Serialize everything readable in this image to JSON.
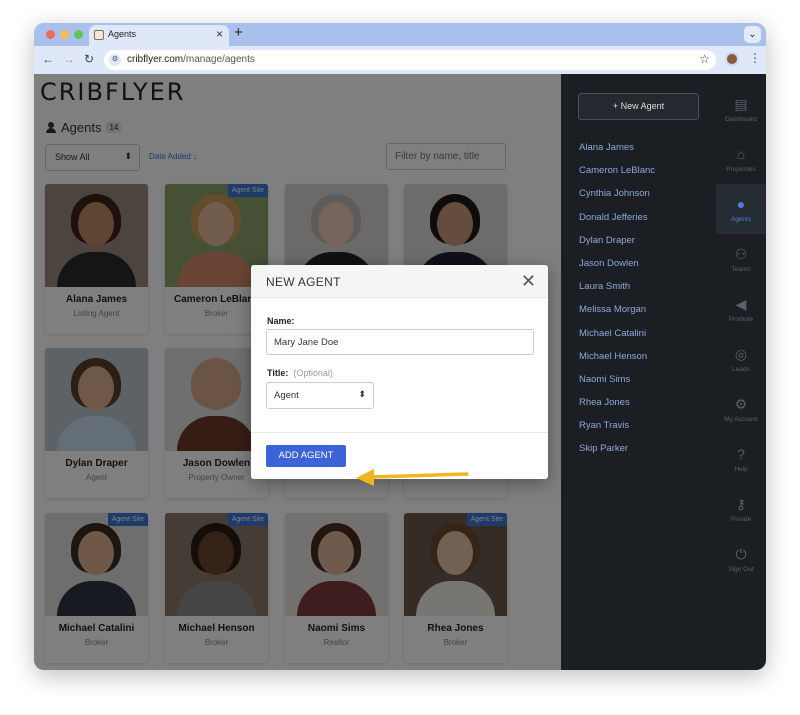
{
  "browser": {
    "tab_title": "Agents",
    "tab_close": "×",
    "new_tab": "+",
    "url_host": "cribflyer.com",
    "url_path": "/manage/agents",
    "menu_glyph": "⌄"
  },
  "page": {
    "logo": "CRIBFLYER",
    "heading": "Agents",
    "count": "14",
    "show_filter": "Show All",
    "sort_label": "Date Added ↓",
    "search_placeholder": "Filter by name, title",
    "badge_text": "Agent Site"
  },
  "cards": [
    {
      "name": "Alana James",
      "role": "Listing Agent",
      "badge": false,
      "skin": "#c28a66",
      "hair": "#3a2216",
      "body": "#2b2b2b"
    },
    {
      "name": "Cameron LeBlanc",
      "role": "Broker",
      "badge": true,
      "skin": "#e2b99a",
      "hair": "#c89a5a",
      "body": "#d48a6a"
    },
    {
      "name": "",
      "role": "",
      "badge": false,
      "skin": "#e8c8b4",
      "hair": "#b8b8b8",
      "body": "#222222"
    },
    {
      "name": "",
      "role": "",
      "badge": false,
      "skin": "#c89a78",
      "hair": "#1e1a18",
      "body": "#1d2430"
    },
    {
      "name": "Dylan Draper",
      "role": "Agent",
      "badge": false,
      "skin": "#e0b090",
      "hair": "#5a3e28",
      "body": "#c9dcee"
    },
    {
      "name": "Jason Dowlen",
      "role": "Property Owner",
      "badge": false,
      "skin": "#d8a888",
      "hair": "#d8a888",
      "body": "#6a3b2a"
    },
    {
      "name": "",
      "role": "",
      "badge": false,
      "skin": "#cccccc",
      "hair": "#bbbbbb",
      "body": "#aaaaaa"
    },
    {
      "name": "",
      "role": "",
      "badge": false,
      "skin": "#cccccc",
      "hair": "#bbbbbb",
      "body": "#aaaaaa"
    },
    {
      "name": "Michael Catalini",
      "role": "Broker",
      "badge": true,
      "skin": "#dcae8c",
      "hair": "#3a2a20",
      "body": "#2e3540"
    },
    {
      "name": "Michael Henson",
      "role": "Broker",
      "badge": true,
      "skin": "#6a452e",
      "hair": "#2a1a12",
      "body": "#8a8a8a"
    },
    {
      "name": "Naomi Sims",
      "role": "Realtor",
      "badge": false,
      "skin": "#e0b49a",
      "hair": "#4a2a1e",
      "body": "#7a3a3a"
    },
    {
      "name": "Rhea Jones",
      "role": "Broker",
      "badge": true,
      "skin": "#e4c0a6",
      "hair": "#6a4a32",
      "body": "#f0ece6"
    }
  ],
  "sidebar": {
    "new_agent_label": "+  New Agent",
    "agents": [
      "Alana James",
      "Cameron LeBlanc",
      "Cynthia Johnson",
      "Donald Jefferies",
      "Dylan Draper",
      "Jason Dowlen",
      "Laura Smith",
      "Melissa Morgan",
      "Michael Catalini",
      "Michael Henson",
      "Naomi Sims",
      "Rhea Jones",
      "Ryan Travis",
      "Skip Parker"
    ]
  },
  "rail": [
    {
      "label": "Dashboard",
      "glyph": "▤",
      "icon": "dashboard-icon",
      "active": false
    },
    {
      "label": "Properties",
      "glyph": "⌂",
      "icon": "properties-icon",
      "active": false
    },
    {
      "label": "Agents",
      "glyph": "●",
      "icon": "agents-icon",
      "active": true
    },
    {
      "label": "Teams",
      "glyph": "⚇",
      "icon": "teams-icon",
      "active": false
    },
    {
      "label": "Promote",
      "glyph": "◀",
      "icon": "megaphone-icon",
      "active": false
    },
    {
      "label": "Leads",
      "glyph": "◎",
      "icon": "leads-icon",
      "active": false
    },
    {
      "label": "My Account",
      "glyph": "⚙",
      "icon": "gear-icon",
      "active": false
    },
    {
      "label": "Help",
      "glyph": "?",
      "icon": "help-icon",
      "active": false
    },
    {
      "label": "Private",
      "glyph": "⚷",
      "icon": "key-icon",
      "active": false
    },
    {
      "label": "Sign Out",
      "glyph": "⏻",
      "icon": "power-icon",
      "active": false
    }
  ],
  "modal": {
    "title": "NEW AGENT",
    "close": "✕",
    "name_label": "Name:",
    "name_value": "Mary Jane Doe",
    "title_label": "Title:",
    "title_optional": "(Optional)",
    "title_value": "Agent",
    "submit_label": "ADD AGENT"
  },
  "colors": {
    "accent": "#3d63d9",
    "arrow": "#f0b41e",
    "panel": "#1b1f24"
  }
}
